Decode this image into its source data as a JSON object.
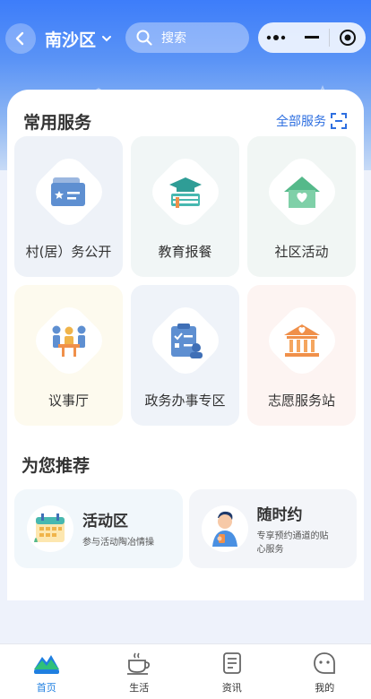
{
  "header": {
    "district": "南沙区",
    "search_placeholder": "搜索"
  },
  "services": {
    "title": "常用服务",
    "all_label": "全部服务",
    "items": [
      {
        "label": "村(居）务公开",
        "icon": "id-card-icon",
        "bg": "#eef2f8"
      },
      {
        "label": "教育报餐",
        "icon": "graduation-cap-icon",
        "bg": "#f1f6f6"
      },
      {
        "label": "社区活动",
        "icon": "house-heart-icon",
        "bg": "#f1f6f4"
      },
      {
        "label": "议事厅",
        "icon": "meeting-icon",
        "bg": "#fdfaee"
      },
      {
        "label": "政务办事专区",
        "icon": "clipboard-icon",
        "bg": "#eff3f9"
      },
      {
        "label": "志愿服务站",
        "icon": "building-heart-icon",
        "bg": "#fdf4f2"
      }
    ]
  },
  "recommend": {
    "title": "为您推荐",
    "items": [
      {
        "name": "活动区",
        "desc": "参与活动陶冶情操",
        "icon": "calendar-icon",
        "bg": "#f1f7fb"
      },
      {
        "name": "随时约",
        "desc": "专享预约通道的贴心服务",
        "icon": "person-phone-icon",
        "bg": "#f3f5f9"
      }
    ]
  },
  "tabs": [
    {
      "label": "首页",
      "icon": "home-mountain-icon",
      "active": true
    },
    {
      "label": "生活",
      "icon": "coffee-cup-icon",
      "active": false
    },
    {
      "label": "资讯",
      "icon": "document-icon",
      "active": false
    },
    {
      "label": "我的",
      "icon": "smile-face-icon",
      "active": false
    }
  ],
  "colors": {
    "accent": "#2e6fe0",
    "header": "#3d7dfa",
    "tab_active": "#1f7fe0"
  }
}
